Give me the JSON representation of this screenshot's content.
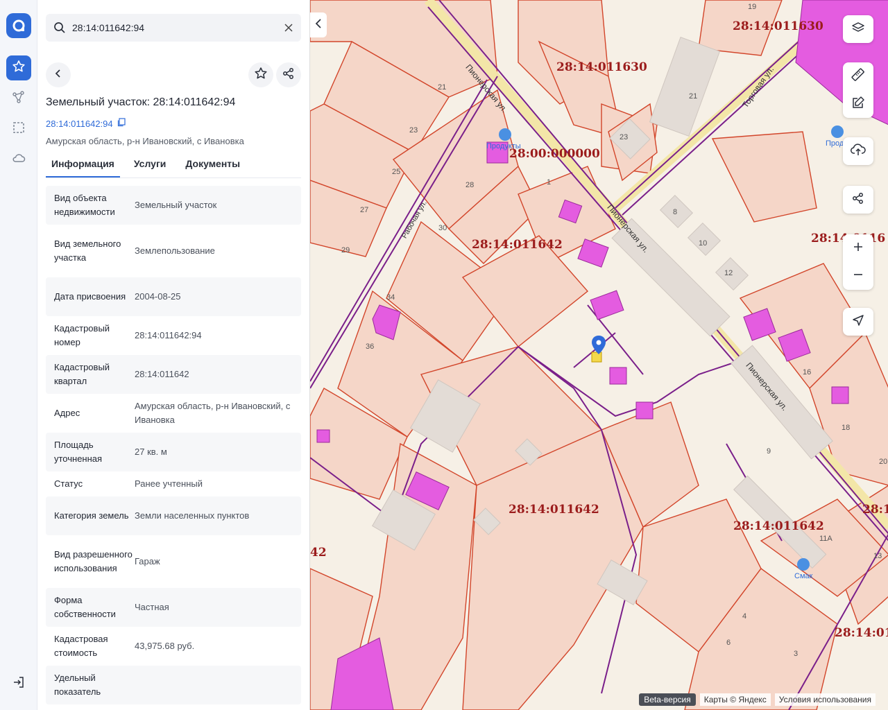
{
  "search": {
    "value": "28:14:011642:94"
  },
  "header": {
    "title": "Земельный участок: 28:14:011642:94",
    "cad_link": "28:14:011642:94",
    "address": "Амурская область, р-н Ивановский, с Ивановка"
  },
  "tabs": [
    "Информация",
    "Услуги",
    "Документы"
  ],
  "props": [
    {
      "k": "Вид объекта недвижимости",
      "v": "Земельный участок"
    },
    {
      "k": "Вид земельного участка",
      "v": "Землепользование"
    },
    {
      "k": "Дата присвоения",
      "v": "2004-08-25"
    },
    {
      "k": "Кадастровый номер",
      "v": "28:14:011642:94"
    },
    {
      "k": "Кадастровый квартал",
      "v": "28:14:011642"
    },
    {
      "k": "Адрес",
      "v": "Амурская область, р-н Ивановский, с Ивановка"
    },
    {
      "k": "Площадь уточненная",
      "v": "27 кв. м"
    },
    {
      "k": "Статус",
      "v": "Ранее учтенный"
    },
    {
      "k": "Категория земель",
      "v": "Земли населенных пунктов"
    },
    {
      "k": "Вид разрешенного использования",
      "v": "Гараж"
    },
    {
      "k": "Форма собственности",
      "v": "Частная"
    },
    {
      "k": "Кадастровая стоимость",
      "v": "43,975.68 руб."
    },
    {
      "k": "Удельный показатель",
      "v": ""
    }
  ],
  "map": {
    "quarter_labels": [
      "28:14:011630",
      "28:14:011630",
      "28:00:000000",
      "28:14:011642",
      "28:14:011642",
      "28:14:011642",
      "28:14:0116",
      "28:14:01",
      "28:14:011642",
      "28:14:01",
      "28:14:011642",
      "42"
    ],
    "streets": [
      "Пионерская ул.",
      "Пионерская ул.",
      "Пионерская ул.",
      "Торговая ул.",
      "Рабочая ул."
    ],
    "house_numbers": [
      "19",
      "21",
      "23",
      "21",
      "23",
      "25",
      "27",
      "28",
      "29",
      "30",
      "34",
      "36",
      "1",
      "8",
      "10",
      "12",
      "16",
      "18",
      "9",
      "11А",
      "4",
      "6",
      "3",
      "13",
      "20"
    ],
    "pois": [
      "Продукты",
      "Смак",
      "Прод"
    ],
    "footer": {
      "beta": "Beta-версия",
      "copyright": "Карты © Яндекс",
      "terms": "Условия использования"
    }
  },
  "colors": {
    "accent": "#2f6bd8",
    "parcel_line": "#d2452a",
    "parcel_fill": "#f5d6c8",
    "purple_line": "#7a1f8a",
    "magenta": "#e45ce0",
    "label": "#9b1c1c"
  },
  "icons": [
    "logo-icon",
    "star-icon",
    "route-icon",
    "select-area-icon",
    "cloud-icon",
    "logout-icon",
    "search-icon",
    "close-icon",
    "back-icon",
    "share-icon",
    "copy-icon",
    "layers-icon",
    "ruler-icon",
    "edit-icon",
    "upload-icon",
    "plus-icon",
    "minus-icon",
    "locate-icon",
    "chevron-left-icon"
  ]
}
